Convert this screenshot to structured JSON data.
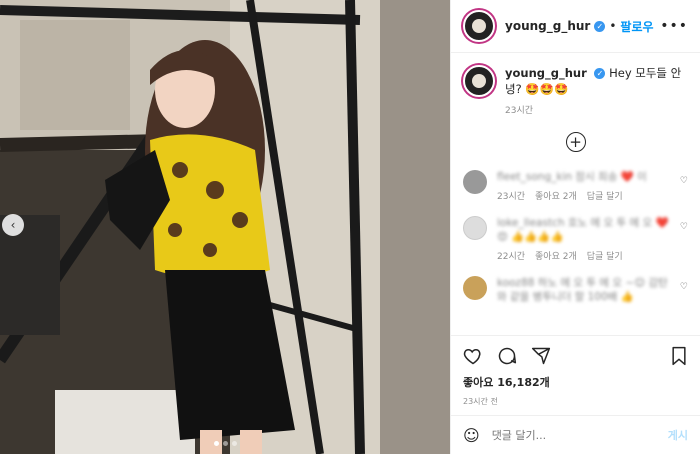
{
  "header": {
    "username": "young_g_hur",
    "separator": "•",
    "follow_label": "팔로우",
    "more_label": "•••"
  },
  "caption": {
    "username": "young_g_hur",
    "text": "Hey 모두들 안녕? 🤩🤩🤩",
    "time": "23시간"
  },
  "comments": [
    {
      "user": "fleet_song_kin",
      "text": "잠시 죄송 ❤️ 이",
      "time": "23시간",
      "likes": "좋아요 2개",
      "reply": "답글 달기"
    },
    {
      "user": "loke_lleastch",
      "text": "호노 에 오 투 에 오 ❤️😍 👍👍👍👍",
      "time": "22시간",
      "likes": "좋아요 2개",
      "reply": "답글 달기"
    },
    {
      "user": "kooz88",
      "text": "하노 에 오 투 에 오 ~😊 감탄 와 같을 병투니더 할 100배 👍",
      "time": "",
      "likes": "",
      "reply": ""
    }
  ],
  "likes_text": "좋아요 16,182개",
  "time_ago": "23시간 전",
  "comment_input": {
    "placeholder": "댓글 달기...",
    "post_label": "게시"
  },
  "colors": {
    "accent": "#0095f6",
    "post_disabled": "#b2dffc",
    "verified": "#3897f0"
  },
  "photo": {
    "carousel_dots": 3,
    "active_dot": 0
  }
}
